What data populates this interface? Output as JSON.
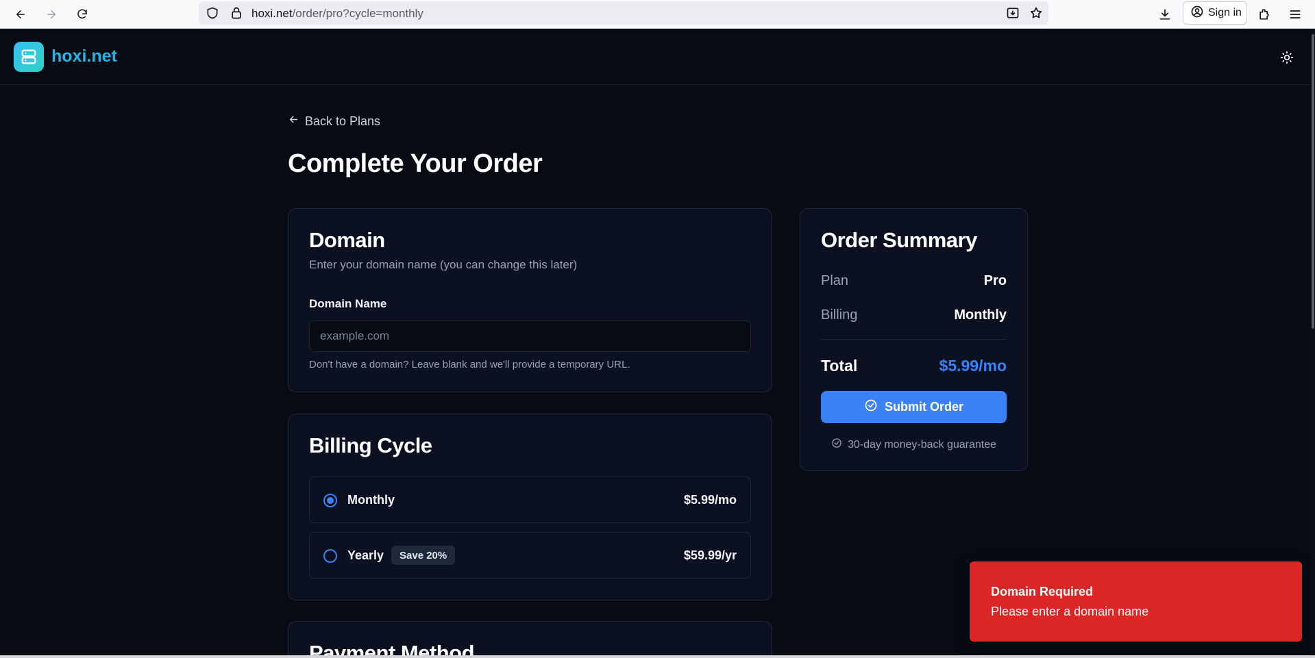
{
  "browser": {
    "url_host": "hoxi.net",
    "url_path": "/order/pro?cycle=monthly",
    "sign_in_label": "Sign in"
  },
  "header": {
    "logo_text": "hoxi.net"
  },
  "main": {
    "back_label": "Back to Plans",
    "page_title": "Complete Your Order"
  },
  "domain": {
    "title": "Domain",
    "subtitle": "Enter your domain name (you can change this later)",
    "field_label": "Domain Name",
    "placeholder": "example.com",
    "value": "",
    "help": "Don't have a domain? Leave blank and we'll provide a temporary URL."
  },
  "billing": {
    "title": "Billing Cycle",
    "options": [
      {
        "label": "Monthly",
        "price": "$5.99/mo",
        "selected": true
      },
      {
        "label": "Yearly",
        "badge": "Save 20%",
        "price": "$59.99/yr",
        "selected": false
      }
    ]
  },
  "payment": {
    "title": "Payment Method"
  },
  "summary": {
    "title": "Order Summary",
    "plan_key": "Plan",
    "plan_value": "Pro",
    "billing_key": "Billing",
    "billing_value": "Monthly",
    "total_key": "Total",
    "total_value": "$5.99/mo",
    "submit_label": "Submit Order",
    "guarantee": "30-day money-back guarantee"
  },
  "toast": {
    "title": "Domain Required",
    "message": "Please enter a domain name"
  },
  "colors": {
    "accent": "#3b82f6",
    "logo": "#22b5e8",
    "error": "#dc2626",
    "background": "#070b14"
  }
}
